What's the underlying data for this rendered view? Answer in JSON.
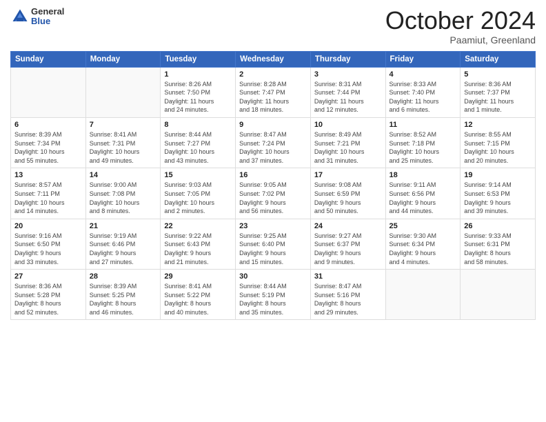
{
  "header": {
    "logo_general": "General",
    "logo_blue": "Blue",
    "month_title": "October 2024",
    "subtitle": "Paamiut, Greenland"
  },
  "days_of_week": [
    "Sunday",
    "Monday",
    "Tuesday",
    "Wednesday",
    "Thursday",
    "Friday",
    "Saturday"
  ],
  "weeks": [
    [
      {
        "day": "",
        "info": ""
      },
      {
        "day": "",
        "info": ""
      },
      {
        "day": "1",
        "info": "Sunrise: 8:26 AM\nSunset: 7:50 PM\nDaylight: 11 hours\nand 24 minutes."
      },
      {
        "day": "2",
        "info": "Sunrise: 8:28 AM\nSunset: 7:47 PM\nDaylight: 11 hours\nand 18 minutes."
      },
      {
        "day": "3",
        "info": "Sunrise: 8:31 AM\nSunset: 7:44 PM\nDaylight: 11 hours\nand 12 minutes."
      },
      {
        "day": "4",
        "info": "Sunrise: 8:33 AM\nSunset: 7:40 PM\nDaylight: 11 hours\nand 6 minutes."
      },
      {
        "day": "5",
        "info": "Sunrise: 8:36 AM\nSunset: 7:37 PM\nDaylight: 11 hours\nand 1 minute."
      }
    ],
    [
      {
        "day": "6",
        "info": "Sunrise: 8:39 AM\nSunset: 7:34 PM\nDaylight: 10 hours\nand 55 minutes."
      },
      {
        "day": "7",
        "info": "Sunrise: 8:41 AM\nSunset: 7:31 PM\nDaylight: 10 hours\nand 49 minutes."
      },
      {
        "day": "8",
        "info": "Sunrise: 8:44 AM\nSunset: 7:27 PM\nDaylight: 10 hours\nand 43 minutes."
      },
      {
        "day": "9",
        "info": "Sunrise: 8:47 AM\nSunset: 7:24 PM\nDaylight: 10 hours\nand 37 minutes."
      },
      {
        "day": "10",
        "info": "Sunrise: 8:49 AM\nSunset: 7:21 PM\nDaylight: 10 hours\nand 31 minutes."
      },
      {
        "day": "11",
        "info": "Sunrise: 8:52 AM\nSunset: 7:18 PM\nDaylight: 10 hours\nand 25 minutes."
      },
      {
        "day": "12",
        "info": "Sunrise: 8:55 AM\nSunset: 7:15 PM\nDaylight: 10 hours\nand 20 minutes."
      }
    ],
    [
      {
        "day": "13",
        "info": "Sunrise: 8:57 AM\nSunset: 7:11 PM\nDaylight: 10 hours\nand 14 minutes."
      },
      {
        "day": "14",
        "info": "Sunrise: 9:00 AM\nSunset: 7:08 PM\nDaylight: 10 hours\nand 8 minutes."
      },
      {
        "day": "15",
        "info": "Sunrise: 9:03 AM\nSunset: 7:05 PM\nDaylight: 10 hours\nand 2 minutes."
      },
      {
        "day": "16",
        "info": "Sunrise: 9:05 AM\nSunset: 7:02 PM\nDaylight: 9 hours\nand 56 minutes."
      },
      {
        "day": "17",
        "info": "Sunrise: 9:08 AM\nSunset: 6:59 PM\nDaylight: 9 hours\nand 50 minutes."
      },
      {
        "day": "18",
        "info": "Sunrise: 9:11 AM\nSunset: 6:56 PM\nDaylight: 9 hours\nand 44 minutes."
      },
      {
        "day": "19",
        "info": "Sunrise: 9:14 AM\nSunset: 6:53 PM\nDaylight: 9 hours\nand 39 minutes."
      }
    ],
    [
      {
        "day": "20",
        "info": "Sunrise: 9:16 AM\nSunset: 6:50 PM\nDaylight: 9 hours\nand 33 minutes."
      },
      {
        "day": "21",
        "info": "Sunrise: 9:19 AM\nSunset: 6:46 PM\nDaylight: 9 hours\nand 27 minutes."
      },
      {
        "day": "22",
        "info": "Sunrise: 9:22 AM\nSunset: 6:43 PM\nDaylight: 9 hours\nand 21 minutes."
      },
      {
        "day": "23",
        "info": "Sunrise: 9:25 AM\nSunset: 6:40 PM\nDaylight: 9 hours\nand 15 minutes."
      },
      {
        "day": "24",
        "info": "Sunrise: 9:27 AM\nSunset: 6:37 PM\nDaylight: 9 hours\nand 9 minutes."
      },
      {
        "day": "25",
        "info": "Sunrise: 9:30 AM\nSunset: 6:34 PM\nDaylight: 9 hours\nand 4 minutes."
      },
      {
        "day": "26",
        "info": "Sunrise: 9:33 AM\nSunset: 6:31 PM\nDaylight: 8 hours\nand 58 minutes."
      }
    ],
    [
      {
        "day": "27",
        "info": "Sunrise: 8:36 AM\nSunset: 5:28 PM\nDaylight: 8 hours\nand 52 minutes."
      },
      {
        "day": "28",
        "info": "Sunrise: 8:39 AM\nSunset: 5:25 PM\nDaylight: 8 hours\nand 46 minutes."
      },
      {
        "day": "29",
        "info": "Sunrise: 8:41 AM\nSunset: 5:22 PM\nDaylight: 8 hours\nand 40 minutes."
      },
      {
        "day": "30",
        "info": "Sunrise: 8:44 AM\nSunset: 5:19 PM\nDaylight: 8 hours\nand 35 minutes."
      },
      {
        "day": "31",
        "info": "Sunrise: 8:47 AM\nSunset: 5:16 PM\nDaylight: 8 hours\nand 29 minutes."
      },
      {
        "day": "",
        "info": ""
      },
      {
        "day": "",
        "info": ""
      }
    ]
  ]
}
